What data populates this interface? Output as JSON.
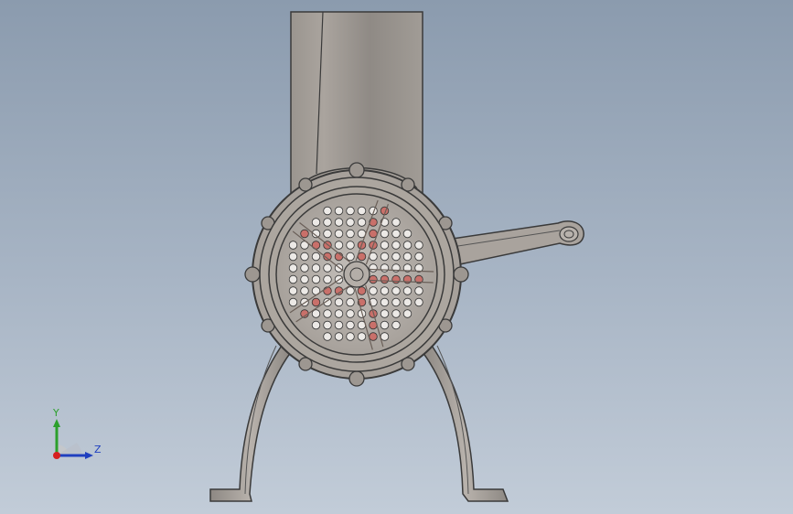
{
  "viewport": {
    "background_top": "#8b9bae",
    "background_bottom": "#c2ccd8"
  },
  "model": {
    "icon": "meat-grinder-model",
    "body_color": "#b0aaa4",
    "edge_color": "#3a3a3a",
    "highlight_color": "#c9706a"
  },
  "triad": {
    "y_label": "Y",
    "z_label": "Z",
    "y_color": "#2ca02c",
    "z_color": "#1f3fbf",
    "origin_color": "#d62020"
  }
}
